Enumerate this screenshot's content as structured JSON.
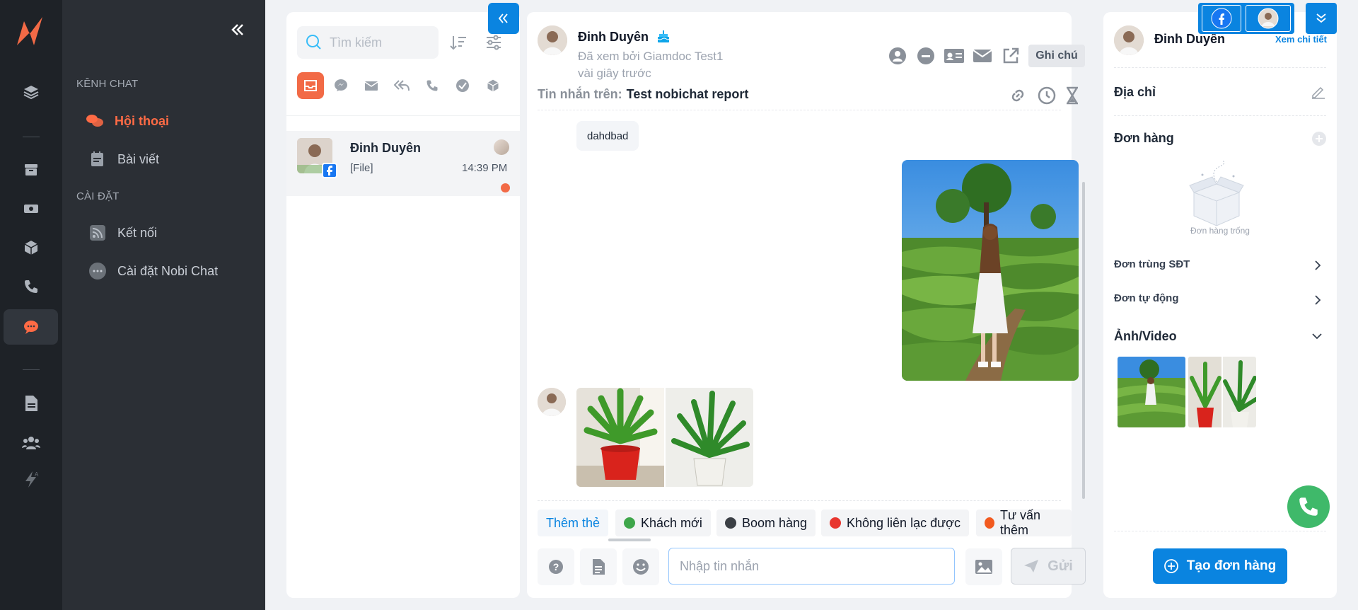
{
  "nav": {
    "section_chat": "KÊNH CHAT",
    "item_conversations": "Hội thoại",
    "item_posts": "Bài viết",
    "section_settings": "CÀI ĐẶT",
    "item_connect": "Kết nối",
    "item_nobi_settings": "Cài đặt Nobi Chat"
  },
  "list": {
    "search_placeholder": "Tìm kiếm",
    "conversations": [
      {
        "name": "Đinh Duyên",
        "preview": "[File]",
        "time": "14:39 PM"
      }
    ]
  },
  "chat": {
    "contact_name": "Đinh Duyên",
    "seen_by": "Đã xem bởi Giamdoc Test1",
    "seen_time": "vài giây trước",
    "message_on_label": "Tin nhắn trên:",
    "page_name": "Test nobichat report",
    "note_button": "Ghi chú",
    "messages": {
      "text1": "dahdbad"
    },
    "add_tag": "Thêm thẻ",
    "tags": [
      {
        "label": "Khách mới",
        "color": "#3ea64a"
      },
      {
        "label": "Boom hàng",
        "color": "#3b3f45"
      },
      {
        "label": "Không liên lạc được",
        "color": "#e8362f"
      },
      {
        "label": "Tư vấn thêm",
        "color": "#f25a1f"
      }
    ],
    "input_placeholder": "Nhập tin nhắn",
    "send_label": "Gửi"
  },
  "customer": {
    "name": "Đinh Duyên",
    "view_detail": "Xem chi tiết",
    "address_label": "Địa chỉ",
    "orders_label": "Đơn hàng",
    "empty_orders": "Đơn hàng trống",
    "duplicate_phone": "Đơn trùng SĐT",
    "auto_orders": "Đơn tự động",
    "media_label": "Ảnh/Video",
    "create_order": "Tạo đơn hàng"
  },
  "colors": {
    "accent": "#f26a46",
    "primary": "#0a84e0",
    "rail": "#1e2227",
    "nav": "#2b2f35"
  }
}
